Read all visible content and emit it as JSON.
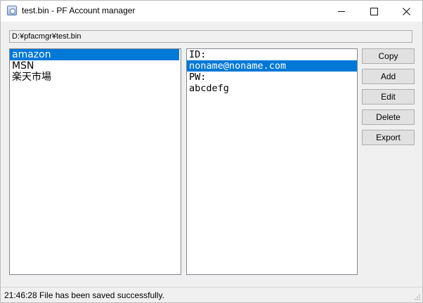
{
  "window": {
    "title": "test.bin - PF Account manager",
    "icon": "app-icon"
  },
  "path": {
    "value": "D:¥pfacmgr¥test.bin"
  },
  "sites": {
    "items": [
      "amazon",
      "MSN",
      "楽天市場"
    ],
    "selected_index": 0
  },
  "details": {
    "items": [
      "ID:",
      "noname@noname.com",
      "PW:",
      "abcdefg"
    ],
    "selected_index": 1
  },
  "buttons": {
    "copy": "Copy",
    "add": "Add",
    "edit": "Edit",
    "delete": "Delete",
    "export": "Export"
  },
  "status": {
    "text": "21:46:28 File has been saved successfully."
  },
  "colors": {
    "selection": "#0078d7",
    "window_bg": "#f0f0f0"
  }
}
